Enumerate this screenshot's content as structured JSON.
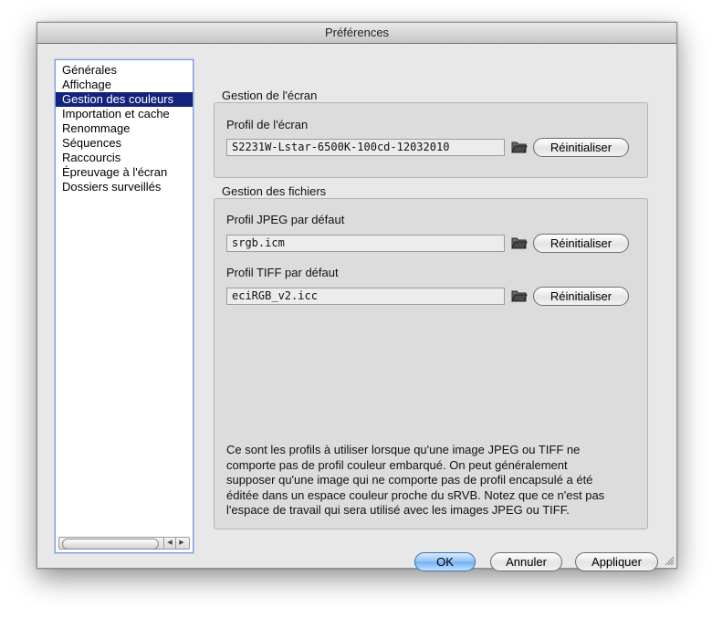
{
  "window": {
    "title": "Préférences"
  },
  "sidebar": {
    "items": [
      {
        "label": "Générales",
        "selected": false
      },
      {
        "label": "Affichage",
        "selected": false
      },
      {
        "label": "Gestion des couleurs",
        "selected": true
      },
      {
        "label": "Importation et cache",
        "selected": false
      },
      {
        "label": "Renommage",
        "selected": false
      },
      {
        "label": "Séquences",
        "selected": false
      },
      {
        "label": "Raccourcis",
        "selected": false
      },
      {
        "label": "Épreuvage à l'écran",
        "selected": false
      },
      {
        "label": "Dossiers surveillés",
        "selected": false
      }
    ],
    "scroll_left_glyph": "◀",
    "scroll_right_glyph": "▶"
  },
  "screen_group": {
    "title": "Gestion de l'écran",
    "profile_label": "Profil de l'écran",
    "profile_value": "S2231W-Lstar-6500K-100cd-12032010",
    "reset_label": "Réinitialiser"
  },
  "files_group": {
    "title": "Gestion des fichiers",
    "jpeg_label": "Profil JPEG par défaut",
    "jpeg_value": "srgb.icm",
    "tiff_label": "Profil TIFF par défaut",
    "tiff_value": "eciRGB_v2.icc",
    "reset_label": "Réinitialiser",
    "note_lines": [
      "Ce sont les profils à utiliser lorsque qu'une image JPEG ou TIFF ne",
      "comporte pas de profil couleur embarqué. On peut généralement",
      "supposer qu'une image qui ne comporte pas de profil encapsulé a été",
      "éditée dans un espace couleur proche du sRVB. Notez que ce n'est pas",
      "l'espace de travail qui sera utilisé avec les images JPEG ou TIFF."
    ]
  },
  "buttons": {
    "ok": "OK",
    "cancel": "Annuler",
    "apply": "Appliquer"
  },
  "icons": {
    "browse": "folder-icon",
    "resize": "resize-grip-icon"
  },
  "colors": {
    "selection": "#13237a",
    "primary_button": "#8fc1f3",
    "focus_ring": "#7d9dd6"
  }
}
